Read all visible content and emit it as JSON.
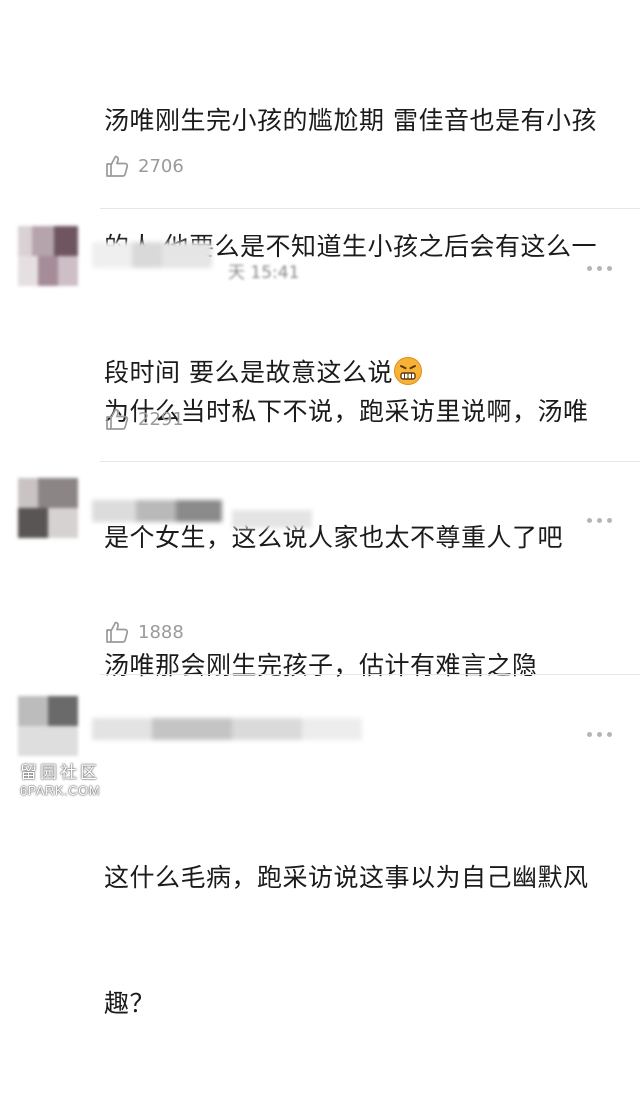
{
  "comments": [
    {
      "text_line1": "汤唯刚生完小孩的尴尬期 雷佳音也是有小孩",
      "text_line2": "的人 他要么是不知道生小孩之后会有这么一",
      "text_line3": "段时间 要么是故意这么说",
      "emoji": "grimacing-angry-emoji",
      "likes": "2706"
    },
    {
      "timestamp_partial": "天 15:41",
      "text_line1": "为什么当时私下不说，跑采访里说啊，汤唯",
      "text_line2": "是个女生，这么说人家也太不尊重人了吧",
      "likes": "2291"
    },
    {
      "text_line1": "汤唯那会刚生完孩子，估计有难言之隐",
      "likes": "1888"
    },
    {
      "text_line1": "这什么毛病，跑采访说这事以为自己幽默风",
      "text_line2": "趣？"
    }
  ],
  "watermark": {
    "line1": "留园社区",
    "line2": "6PARK.COM"
  },
  "icons": {
    "like": "thumbs-up-icon",
    "more": "more-dots-icon"
  },
  "colors": {
    "text": "#1b1b1b",
    "muted": "#9a9a9a",
    "divider": "#e6e6e6",
    "emoji": "#f5a623"
  }
}
